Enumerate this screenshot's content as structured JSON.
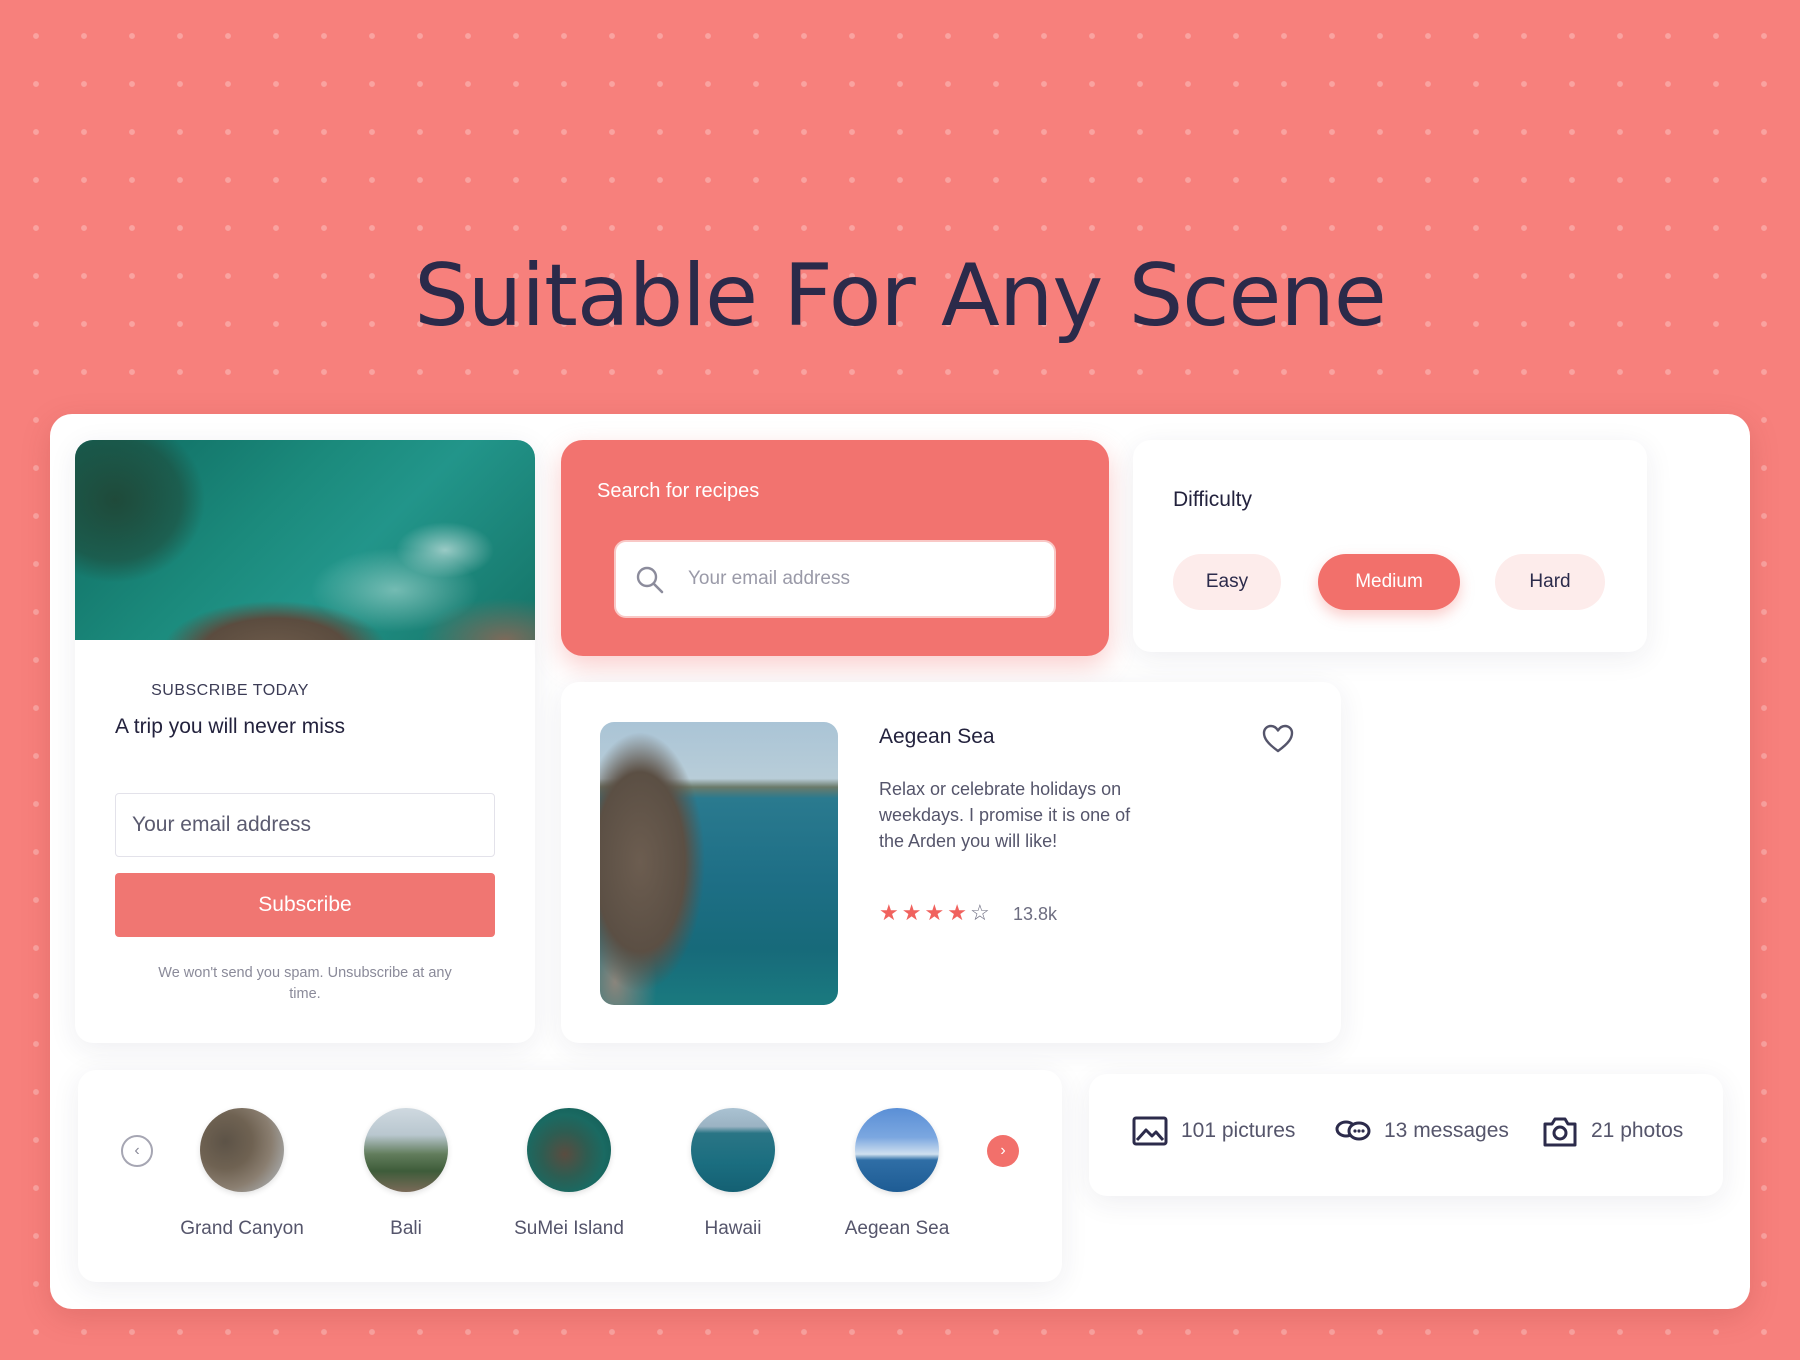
{
  "headline": "Suitable For Any Scene",
  "subscribe": {
    "eyebrow": "SUBSCRIBE TODAY",
    "title": "A trip you will never miss",
    "email_placeholder": "Your email address",
    "button_label": "Subscribe",
    "note": "We won't send you spam. Unsubscribe at any time."
  },
  "search": {
    "label": "Search for recipes",
    "placeholder": "Your email address",
    "icon": "search-icon"
  },
  "difficulty": {
    "title": "Difficulty",
    "options": [
      "Easy",
      "Medium",
      "Hard"
    ],
    "selected": "Medium"
  },
  "destination_card": {
    "title": "Aegean Sea",
    "description": "Relax or celebrate holidays on weekdays. I promise it is one of the Arden you will like!",
    "rating": 4,
    "rating_max": 5,
    "reviews": "13.8k",
    "icon": "heart-icon"
  },
  "destinations": {
    "items": [
      "Grand Canyon",
      "Bali",
      "SuMei Island",
      "Hawaii",
      "Aegean Sea"
    ],
    "prev_icon": "chevron-left-icon",
    "next_icon": "chevron-right-icon"
  },
  "stats": [
    {
      "label": "101 pictures",
      "icon": "image-icon"
    },
    {
      "label": "13 messages",
      "icon": "chat-icon"
    },
    {
      "label": "21 photos",
      "icon": "camera-icon"
    }
  ],
  "colors": {
    "background": "#f7807c",
    "accent": "#f2706b",
    "pill_inactive": "#fdeceb",
    "text_dark": "#2c2b4b"
  }
}
